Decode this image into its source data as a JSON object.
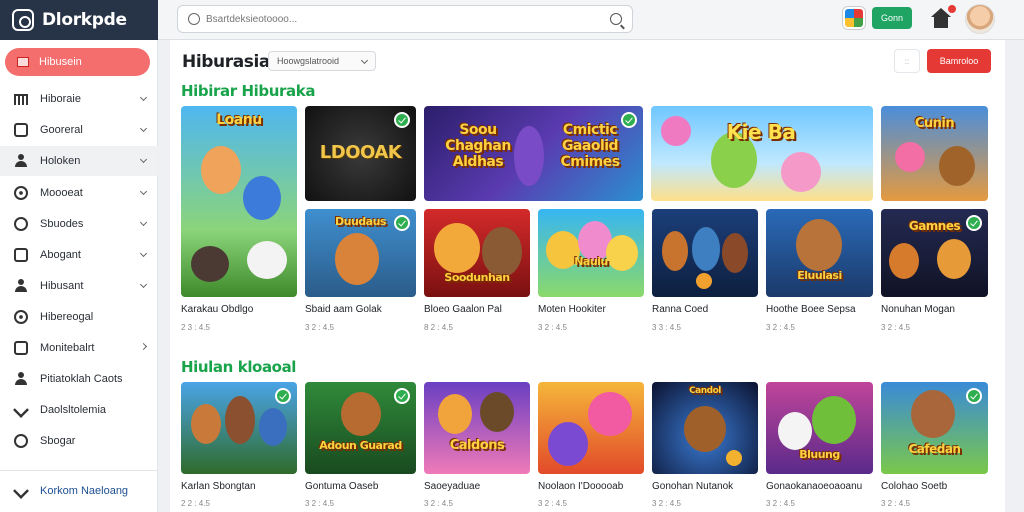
{
  "app": {
    "name": "Dlorkpde"
  },
  "search": {
    "placeholder": "Bsartdeksieotoooo..."
  },
  "header": {
    "green_button": "Gonn"
  },
  "sidebar": {
    "active_label": "Hibusein",
    "items": [
      {
        "label": "Hiboraie"
      },
      {
        "label": "Gooreral"
      },
      {
        "label": "Holoken"
      },
      {
        "label": "Moooeat"
      },
      {
        "label": "Sbuodes"
      },
      {
        "label": "Abogant"
      },
      {
        "label": "Hibusant"
      },
      {
        "label": "Hibereogal"
      },
      {
        "label": "Monitebalrt"
      },
      {
        "label": "Pitiatoklah Caots"
      },
      {
        "label": "Daolsltolemia"
      },
      {
        "label": "Sbogar"
      }
    ],
    "bottom_label": "Korkom Naeloang"
  },
  "main": {
    "title": "Hiburasia",
    "filter_label": "Hoowgslatrooid",
    "small_box_label": "::",
    "red_button": "Bamroloo",
    "section1_title": "Hibirar Hiburaka",
    "section2_title": "Hiulan kloaoal"
  },
  "cards_row1": [
    {
      "title": "Karakau Obdlgo",
      "meta": "2 3 : 4.5",
      "art_text": "Loanu"
    },
    {
      "title": "Sbaid aam Golak",
      "meta": "3 2 : 4.5",
      "art_text": "LDOOAK"
    },
    {
      "title": "",
      "meta": "",
      "art_text": "Soou Chaghan Aldhas"
    },
    {
      "title": "",
      "meta": "",
      "art_text": "Cmictic Gaaolid Cmimes"
    },
    {
      "title": "",
      "meta": "",
      "art_text": "Kie Ba"
    },
    {
      "title": "",
      "meta": "",
      "art_text": "Cunin"
    }
  ],
  "cards_row2": [
    {
      "title": "",
      "meta": "",
      "art_text": "Duudaus"
    },
    {
      "title": "Bloeo Gaalon Pal",
      "meta": "8 2 : 4.5",
      "art_text": "Soodunhan"
    },
    {
      "title": "Moten Hookiter",
      "meta": "3 2 : 4.5",
      "art_text": "Nauiu"
    },
    {
      "title": "Ranna Coed",
      "meta": "3 3 : 4.5",
      "art_text": ""
    },
    {
      "title": "Hoothe Boee Sepsa",
      "meta": "3 2 : 4.5",
      "art_text": "Eluulasi"
    },
    {
      "title": "Nonuhan Mogan",
      "meta": "3 2 : 4.5",
      "art_text": "Gamnes"
    }
  ],
  "cards_row3": [
    {
      "title": "Karlan Sbongtan",
      "meta": "2 2 : 4.5",
      "art_text": ""
    },
    {
      "title": "Gontuma Oaseb",
      "meta": "3 2 : 4.5",
      "art_text": "Adoun Guarad"
    },
    {
      "title": "Saoeyaduae",
      "meta": "3 2 : 4.5",
      "art_text": "Caldons"
    },
    {
      "title": "Noolaon I'Dooooab",
      "meta": "3 2 : 4.5",
      "art_text": ""
    },
    {
      "title": "Gonohan Nutanok",
      "meta": "3 2 : 4.5",
      "art_text": "Candol"
    },
    {
      "title": "Gonaokanaoeoaoanu",
      "meta": "3 2 : 4.5",
      "art_text": "Bluung"
    },
    {
      "title": "Colohao Soetb",
      "meta": "3 2 : 4.5",
      "art_text": "Cafedan"
    }
  ],
  "colors": {
    "accent_red": "#e53935",
    "brand_green": "#19a34a",
    "sidebar_active": "#f46e6e",
    "logo_bg": "#273447"
  }
}
